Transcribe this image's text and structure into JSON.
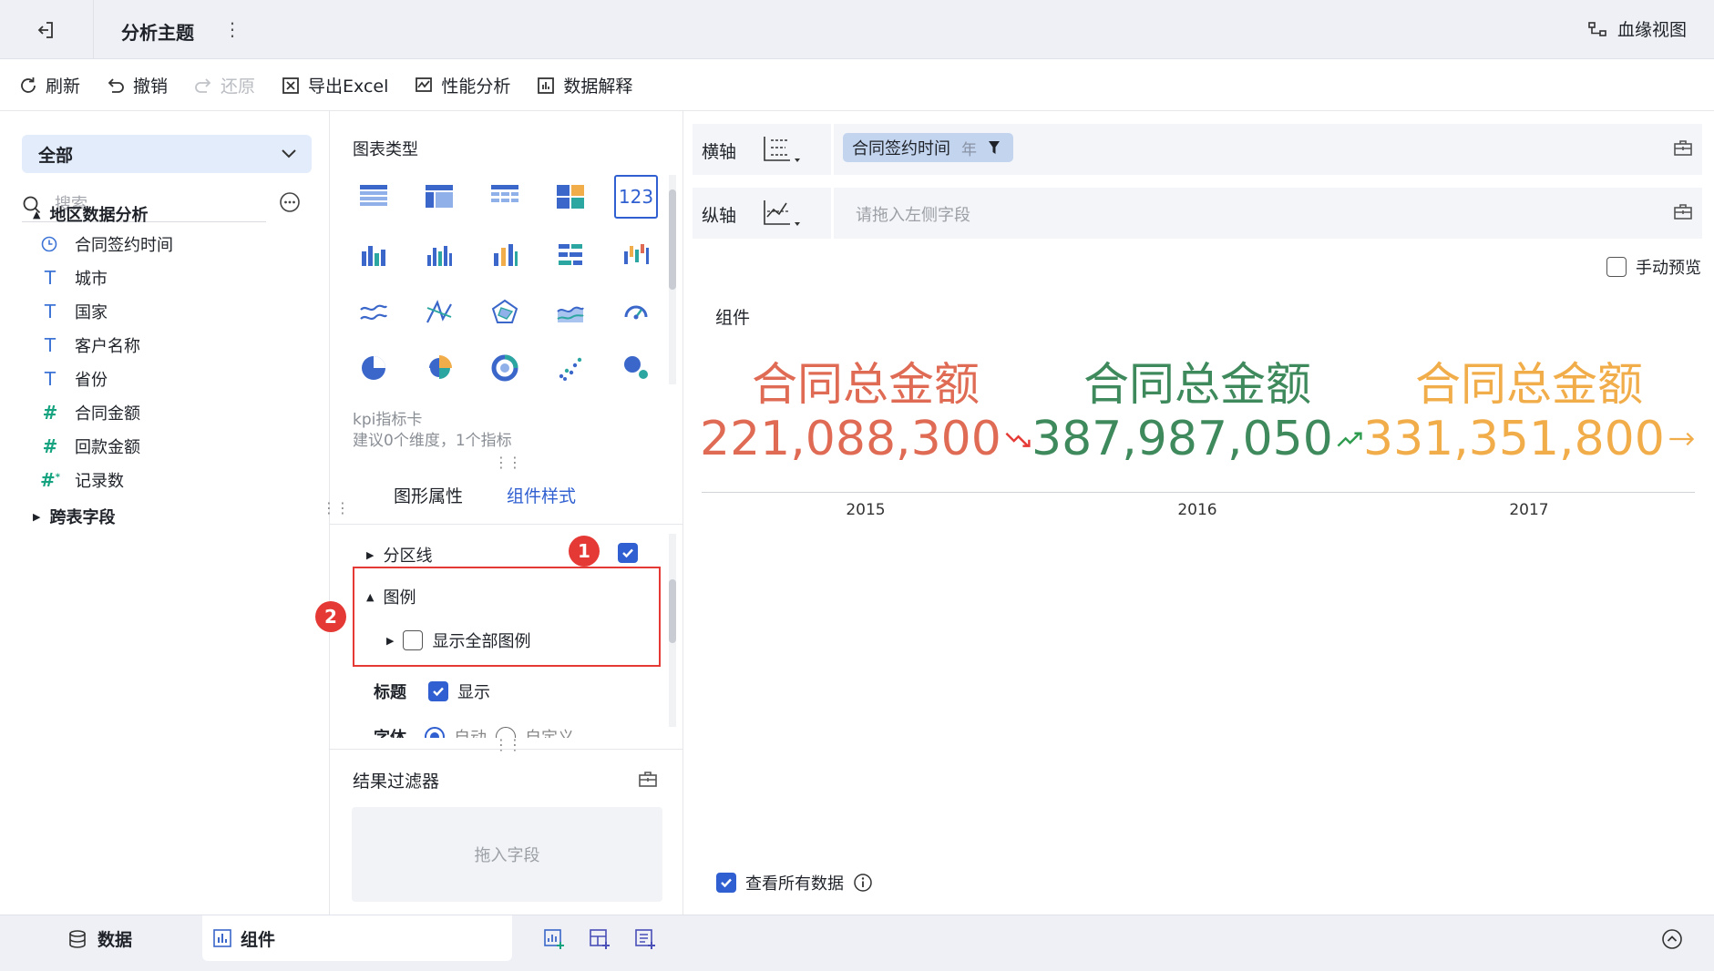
{
  "header": {
    "title": "分析主题",
    "more": "⋮",
    "lineage_label": "血缘视图"
  },
  "toolbar": {
    "refresh": "刷新",
    "undo": "撤销",
    "redo": "还原",
    "export_excel": "导出Excel",
    "performance": "性能分析",
    "data_explain": "数据解释"
  },
  "left": {
    "scope": "全部",
    "search_placeholder": "搜索",
    "group1": "地区数据分析",
    "fields": [
      {
        "label": "合同签约时间",
        "type": "date"
      },
      {
        "label": "城市",
        "type": "text"
      },
      {
        "label": "国家",
        "type": "text"
      },
      {
        "label": "客户名称",
        "type": "text"
      },
      {
        "label": "省份",
        "type": "text"
      },
      {
        "label": "合同金额",
        "type": "number"
      },
      {
        "label": "回款金额",
        "type": "number"
      },
      {
        "label": "记录数",
        "type": "count"
      }
    ],
    "group2": "跨表字段"
  },
  "middle": {
    "chart_type_title": "图表类型",
    "selected_chart_icon_text": "123",
    "kpi_name": "kpi指标卡",
    "kpi_hint": "建议0个维度，1个指标",
    "tab_props": "图形属性",
    "tab_style": "组件样式",
    "marker1": "1",
    "marker2": "2",
    "divider_label": "分区线",
    "divider_checked": true,
    "legend_label": "图例",
    "show_all_legend": "显示全部图例",
    "show_all_legend_checked": false,
    "title_label": "标题",
    "title_show": "显示",
    "title_show_checked": true,
    "font_label": "字体",
    "font_auto": "自动",
    "font_custom": "自定义",
    "filter_title": "结果过滤器",
    "filter_drop": "拖入字段"
  },
  "right": {
    "x_axis_label": "横轴",
    "x_field": "合同签约时间",
    "x_granularity": "年",
    "y_axis_label": "纵轴",
    "y_placeholder": "请拖入左侧字段",
    "manual_preview": "手动预览",
    "manual_preview_checked": false,
    "component_title": "组件",
    "kpis": [
      {
        "name": "合同总金额",
        "value": "221,088,300",
        "trend": "down",
        "year": "2015",
        "color": "#e06b55"
      },
      {
        "name": "合同总金额",
        "value": "387,987,050",
        "trend": "up",
        "year": "2016",
        "color": "#3f8a5c"
      },
      {
        "name": "合同总金额",
        "value": "331,351,800",
        "trend": "flat",
        "year": "2017",
        "color": "#f2ad4b"
      }
    ],
    "view_all_data": "查看所有数据",
    "view_all_checked": true
  },
  "bottom": {
    "tab_data": "数据",
    "tab_component": "组件"
  },
  "colors": {
    "accent": "#2f5fd0",
    "highlight_box": "#e53935",
    "trend_down": "#e53935",
    "trend_up": "#2e9b4f",
    "trend_flat": "#f2ad4b"
  }
}
